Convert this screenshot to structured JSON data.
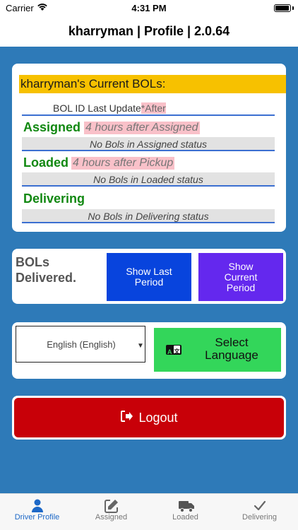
{
  "status_bar": {
    "carrier": "Carrier",
    "time": "4:31 PM"
  },
  "nav": {
    "title": "kharryman | Profile | 2.0.64"
  },
  "bols": {
    "header": "kharryman's Current BOLs:",
    "columns": {
      "id_label": "BOL ID",
      "update_label": "Last Update",
      "after_label": "*After"
    },
    "sections": [
      {
        "title": "Assigned",
        "subtitle": "4 hours after Assigned",
        "empty": "No Bols in Assigned status"
      },
      {
        "title": "Loaded",
        "subtitle": "4 hours after Pickup",
        "empty": "No Bols in Loaded status"
      },
      {
        "title": "Delivering",
        "subtitle": "",
        "empty": "No Bols in Delivering status"
      }
    ]
  },
  "delivered": {
    "label": "BOLs Delivered.",
    "show_last": "Show Last Period",
    "show_current": "Show Current Period"
  },
  "language": {
    "selected": "English (English)",
    "button_label": "Select Language",
    "icon_text": "A",
    "icon_text2": "文"
  },
  "logout": {
    "label": "Logout"
  },
  "tabs": [
    {
      "label": "Driver Profile",
      "icon": "person-icon",
      "active": true
    },
    {
      "label": "Assigned",
      "icon": "edit-icon",
      "active": false
    },
    {
      "label": "Loaded",
      "icon": "truck-icon",
      "active": false
    },
    {
      "label": "Delivering",
      "icon": "checkmark-icon",
      "active": false
    }
  ],
  "colors": {
    "main_bg": "#2e7ab8",
    "header_yellow": "#f7c100",
    "section_green": "#118811",
    "last_period_blue": "#0844dd",
    "current_period_purple": "#6428ee",
    "language_green": "#33d65a",
    "logout_red": "#c80008",
    "tab_active": "#1d68c7"
  }
}
